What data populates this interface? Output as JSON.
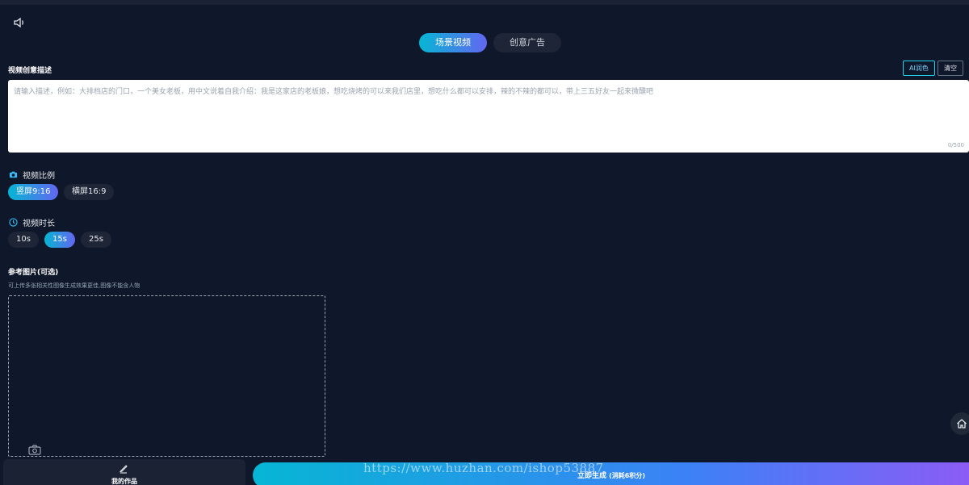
{
  "tabs": [
    {
      "label": "场景视频",
      "active": true
    },
    {
      "label": "创意广告",
      "active": false
    }
  ],
  "description": {
    "title": "视频创意描述",
    "ai_button": "AI润色",
    "clear_button": "清空",
    "placeholder": "请输入描述，例如：大排档店的门口，一个美女老板，用中文说着自我介绍：我是这家店的老板娘，想吃烧烤的可以来我们店里，想吃什么都可以安排，辣的不辣的都可以，带上三五好友一起来微醺吧",
    "count": "0/500"
  },
  "ratio": {
    "label": "视频比例",
    "options": [
      "竖屏9:16",
      "横屏16:9"
    ],
    "selected": "竖屏9:16"
  },
  "duration": {
    "label": "视频时长",
    "options": [
      "10s",
      "15s",
      "25s"
    ],
    "selected": "15s"
  },
  "reference": {
    "title": "参考图片(可选)",
    "hint": "可上传多张相关性图像生成效果更佳,图像不能含人物"
  },
  "footer": {
    "my_works": "我的作品",
    "generate": "立即生成",
    "cost": "(消耗6积分)"
  },
  "watermark": "https://www.huzhan.com/ishop53887",
  "colors": {
    "background": "#0f172a",
    "accent_start": "#06b6d4",
    "accent_end": "#6366f1"
  },
  "icons": [
    "speaker-icon",
    "camera-icon",
    "clock-icon",
    "pen-icon",
    "home-icon"
  ]
}
